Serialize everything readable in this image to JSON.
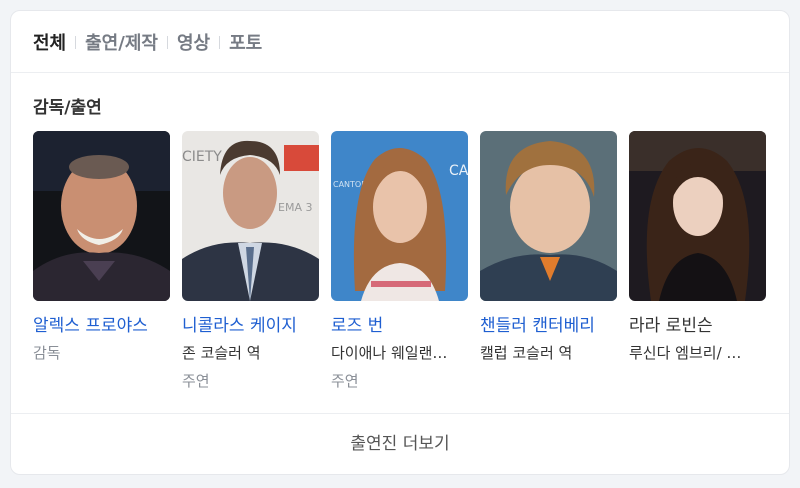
{
  "tabs": [
    {
      "label": "전체"
    },
    {
      "label": "출연/제작"
    },
    {
      "label": "영상"
    },
    {
      "label": "포토"
    }
  ],
  "section": {
    "title": "감독/출연"
  },
  "people": [
    {
      "name": "알렉스 프로야스",
      "role": "감독",
      "sub": ""
    },
    {
      "name": "니콜라스 케이지",
      "role": "존 코슬러 역",
      "sub": "주연"
    },
    {
      "name": "로즈 번",
      "role": "다이애나 웨일랜…",
      "sub": "주연"
    },
    {
      "name": "챈들러 캔터베리",
      "role": "캘럽 코슬러 역",
      "sub": ""
    },
    {
      "name": "라라 로빈슨",
      "role": "루신다 엠브리/ …",
      "sub": ""
    }
  ],
  "more": {
    "label": "출연진 더보기"
  },
  "colors": {
    "link": "#1f5fd1",
    "muted": "#8a8f97",
    "text": "#222222"
  }
}
